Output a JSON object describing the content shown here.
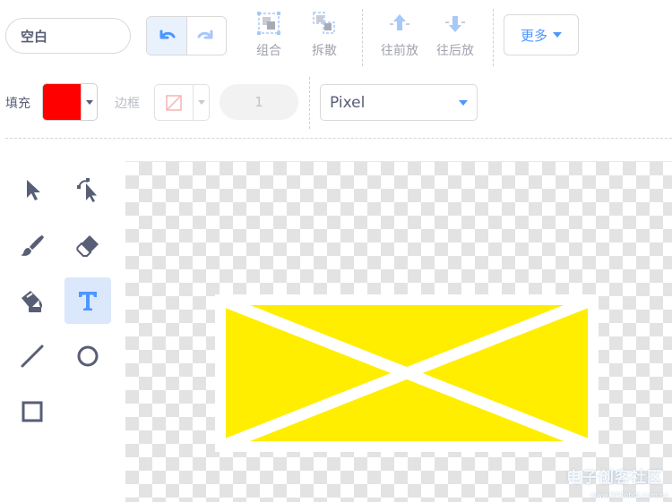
{
  "costume": {
    "name": "空白"
  },
  "toolbar": {
    "group_label": "组合",
    "ungroup_label": "拆散",
    "forward_label": "往前放",
    "backward_label": "往后放",
    "more_label": "更多"
  },
  "style_bar": {
    "fill_label": "填充",
    "fill_color": "#ff0000",
    "outline_label": "边框",
    "outline_width": "1",
    "font": "Pixel"
  },
  "colors": {
    "accent": "#4c97ff",
    "shape_fill": "#ffee00",
    "shape_stroke": "#ffffff"
  },
  "watermark": {
    "text": "电子创客社区",
    "subtext": "www.DFRobot.com.cn"
  }
}
